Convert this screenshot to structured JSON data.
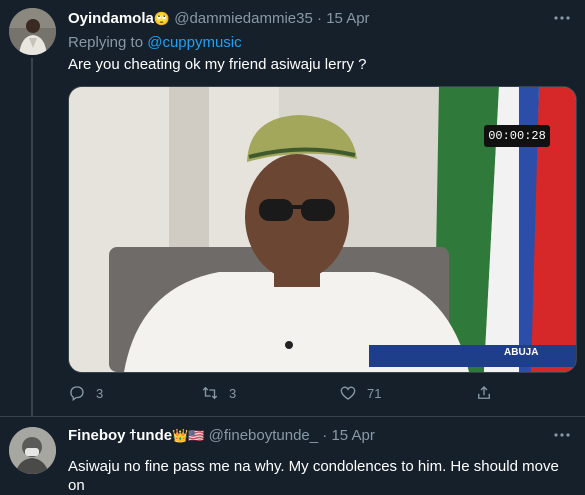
{
  "tweets": [
    {
      "display_name": "Oyindamola",
      "emoji": "🙄",
      "handle": "@dammiedammie35",
      "separator": "·",
      "date": "15 Apr",
      "replying_label": "Replying to",
      "replying_handle": "@cuppymusic",
      "text": "Are you cheating ok my friend asiwaju lerry ?",
      "media": {
        "timecode": "00:00:28",
        "location_caption": "ABUJA"
      },
      "actions": {
        "replies": "3",
        "retweets": "3",
        "likes": "71"
      }
    },
    {
      "display_name": "Fineboy ϯunde",
      "emoji": "👑🇺🇸",
      "handle": "@fineboytunde_",
      "separator": "·",
      "date": "15 Apr",
      "text": "Asiwaju no fine pass me na why. My condolences to him. He should move on"
    }
  ],
  "icons": {
    "more": "more-horizontal-icon",
    "reply": "reply-icon",
    "retweet": "retweet-icon",
    "like": "heart-icon",
    "share": "share-icon"
  },
  "colors": {
    "background": "#15202b",
    "muted": "#8899a6",
    "link": "#1da1f2",
    "divider": "#38444d"
  }
}
